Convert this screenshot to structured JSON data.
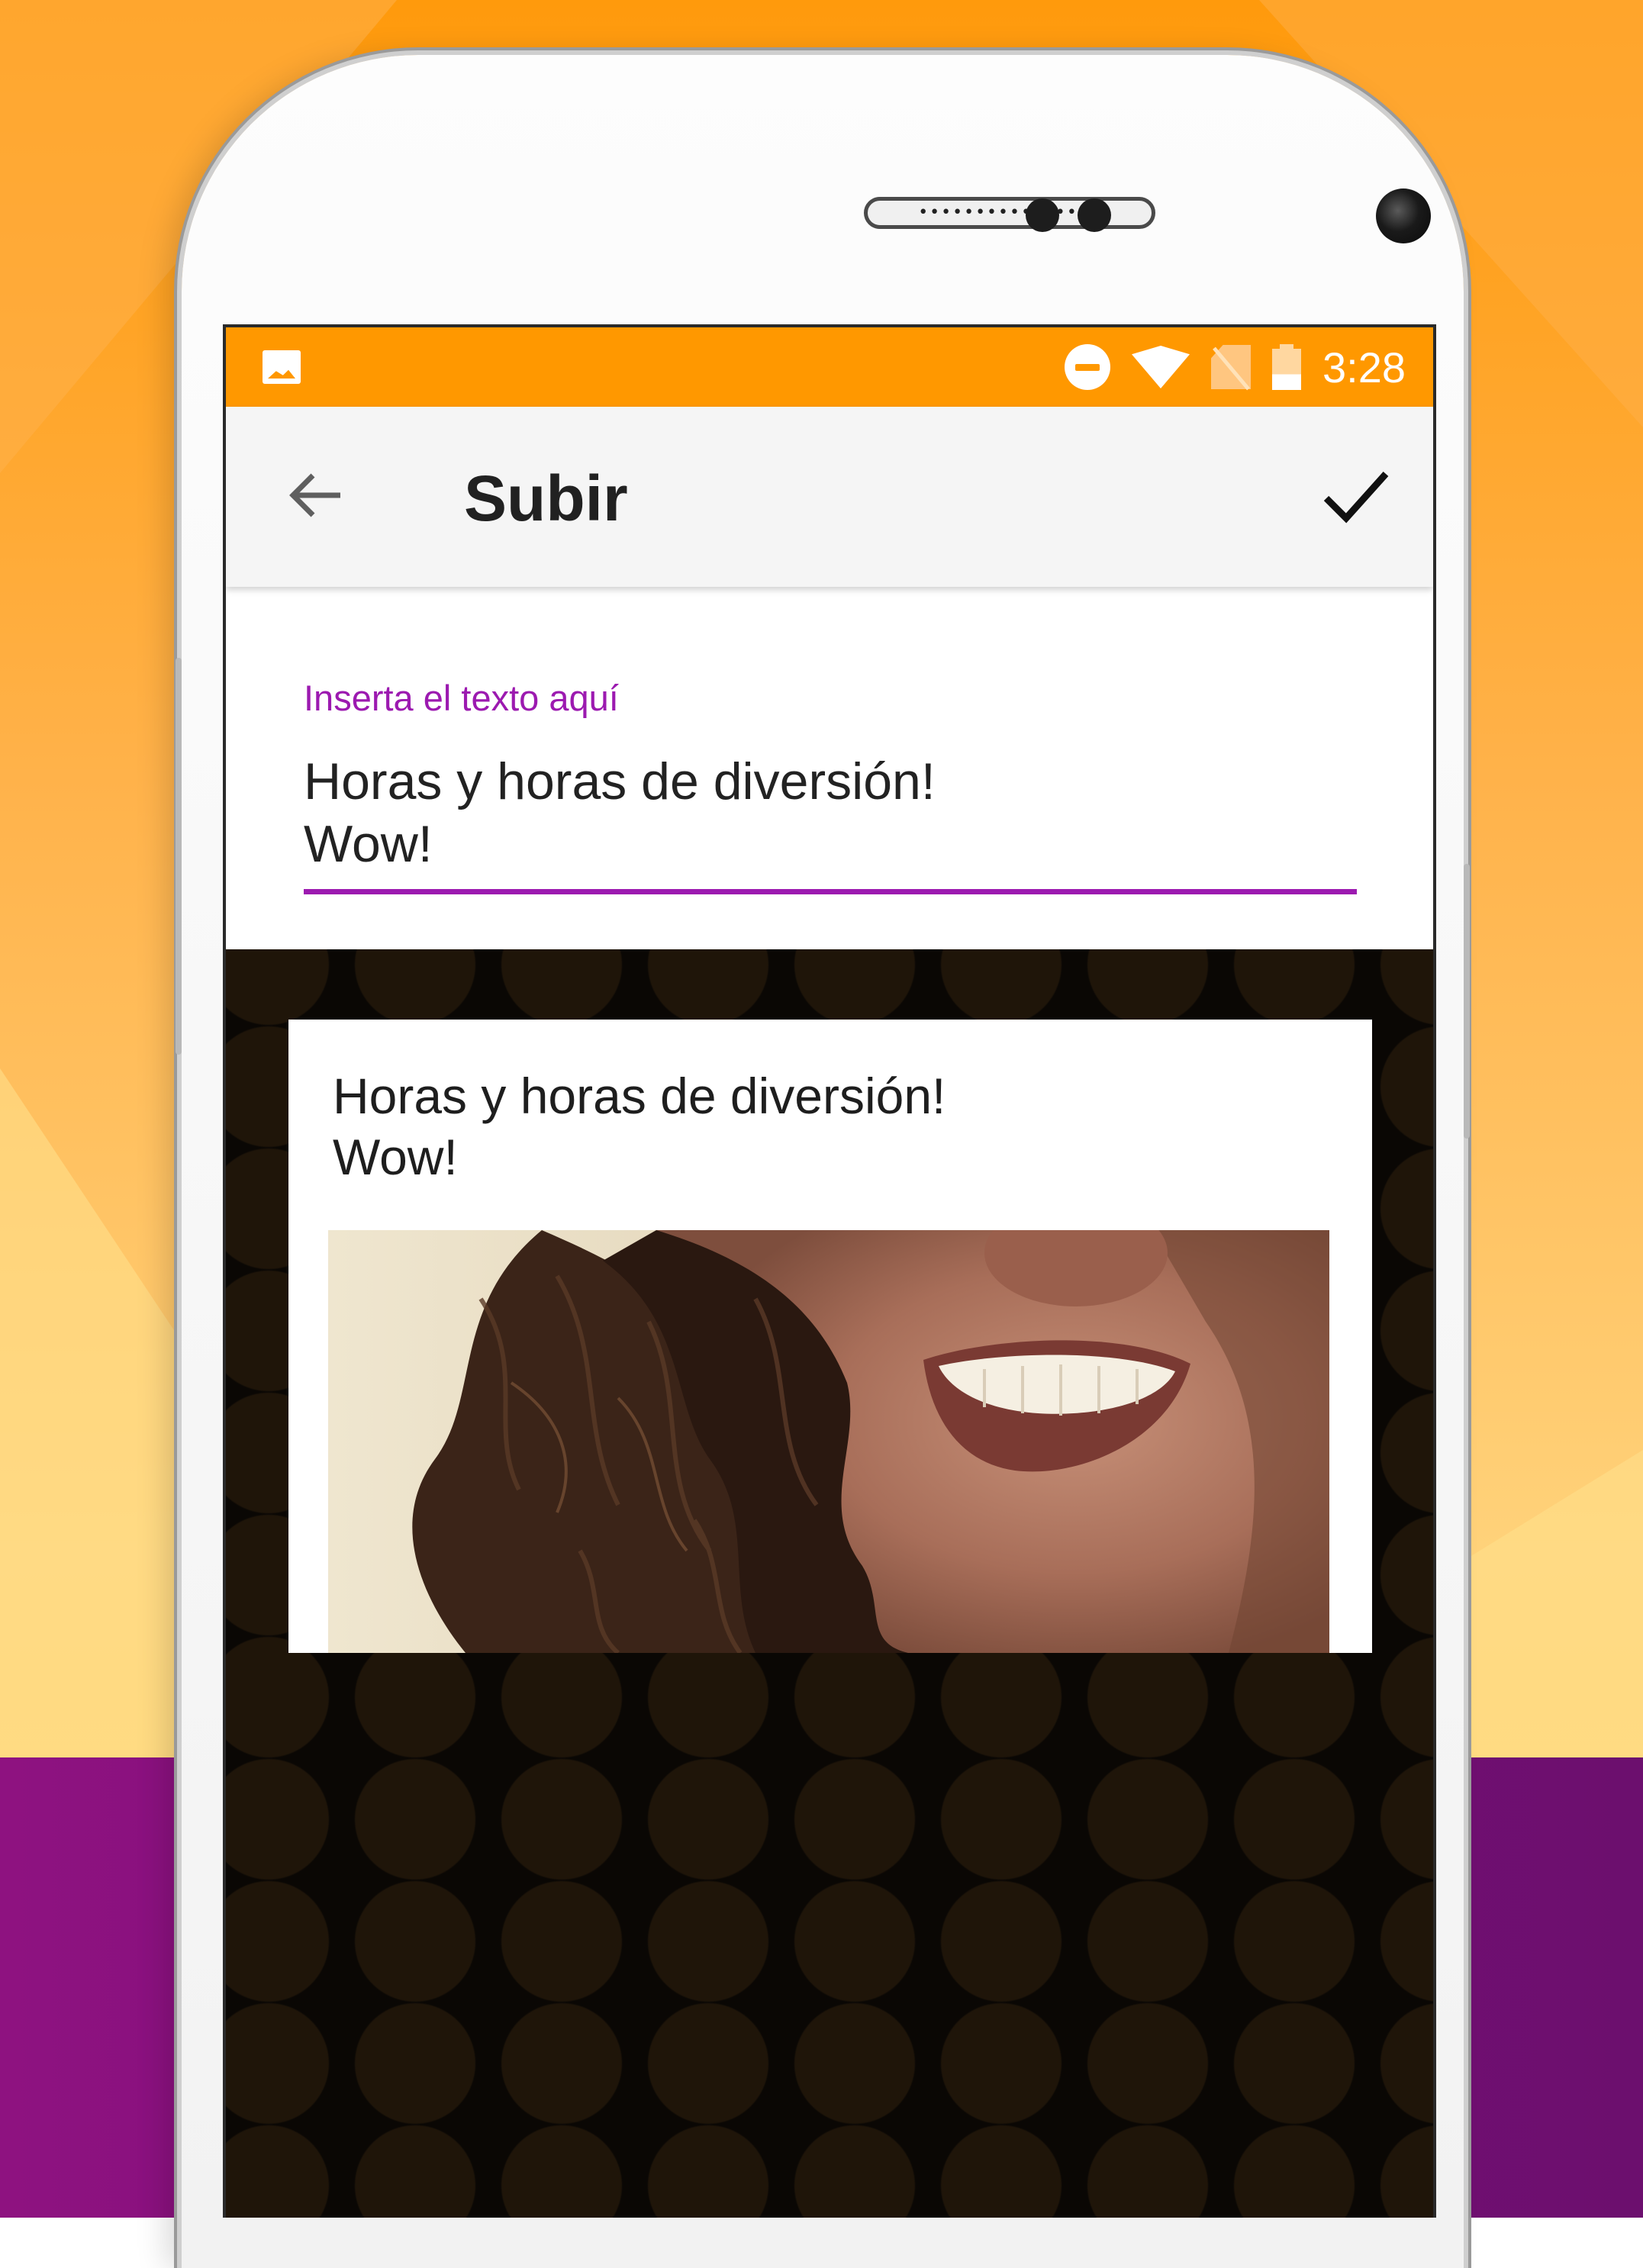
{
  "status_bar": {
    "time": "3:28",
    "icons": [
      "gallery-icon",
      "do-not-disturb-icon",
      "wifi-icon",
      "no-sim-icon",
      "battery-icon"
    ]
  },
  "app_bar": {
    "back_icon": "arrow-left-icon",
    "title": "Subir",
    "confirm_icon": "check-icon"
  },
  "form": {
    "label": "Inserta el texto aquí",
    "value": "Horas y horas de diversión!\nWow!"
  },
  "preview": {
    "text": "Horas y horas de diversión!\nWow!"
  },
  "colors": {
    "status_bar": "#ff9800",
    "accent": "#9c1ab0",
    "app_bar": "#f5f5f5",
    "background_band": "#7a0d78"
  }
}
